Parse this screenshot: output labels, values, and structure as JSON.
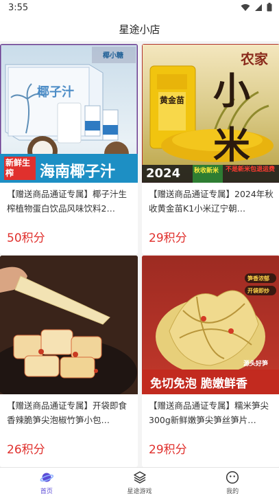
{
  "status": {
    "time": "3:55"
  },
  "header": {
    "title": "星途小店"
  },
  "products": [
    {
      "title": "【赠送商品通证专属】椰子汁生榨植物蛋白饮品风味饮料2…",
      "price": "50积分",
      "image": {
        "brand": "椰小糖",
        "product_name": "椰子汁",
        "tag": "新鲜生榨",
        "banner": "海南椰子汁"
      }
    },
    {
      "title": "【赠送商品通证专属】2024年秋收黄金苗K1小米辽宁朝…",
      "price": "29积分",
      "image": {
        "heading": "农家",
        "big": "小米",
        "bag": "黄金苗",
        "year": "2024",
        "tag": "秋收新米",
        "note": "不是新米包退运费"
      }
    },
    {
      "title": "【赠送商品通证专属】开袋即食香辣脆笋尖泡椒竹笋小包…",
      "price": "26积分",
      "image": {}
    },
    {
      "title": "【赠送商品通证专属】糯米笋尖300g新鲜嫩笋尖笋丝笋片…",
      "price": "29积分",
      "image": {
        "caption": "源头好笋",
        "badges": [
          "笋香浓郁",
          "开袋即炒"
        ],
        "banner": "免切免泡 脆嫩鲜香"
      }
    }
  ],
  "nav": [
    {
      "label": "首页",
      "icon": "planet-icon",
      "active": true
    },
    {
      "label": "星途游戏",
      "icon": "layers-icon",
      "active": false
    },
    {
      "label": "我的",
      "icon": "smiley-icon",
      "active": false
    }
  ],
  "colors": {
    "price": "#e0302d",
    "active_nav": "#5b4bd6"
  }
}
